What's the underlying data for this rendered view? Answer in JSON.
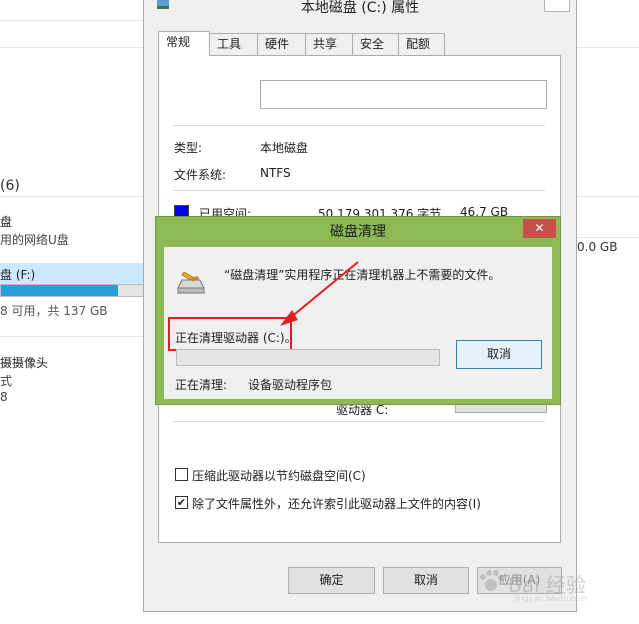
{
  "background_explorer": {
    "group_header": "(6)",
    "device_name_partial": "盘",
    "device_desc_partial": "用的网络U盘",
    "drive_label_partial": "盘 (F:)",
    "drive_free_partial": "8 可用，共 137 GB",
    "camera_name_partial": "摄摄像头",
    "camera_line2": "式",
    "camera_line3": "8",
    "right_size_partial": "0.0 GB",
    "drive_fill_percent": 81
  },
  "properties_dialog": {
    "title": "本地磁盘 (C:) 属性",
    "tabs": [
      "常规",
      "工具",
      "硬件",
      "共享",
      "安全",
      "配额"
    ],
    "active_tab": "常规",
    "name_value": "",
    "type_label": "类型:",
    "type_value": "本地磁盘",
    "fs_label": "文件系统:",
    "fs_value": "NTFS",
    "used_label": "已用空间:",
    "used_bytes": "50,179,301,376 字节",
    "used_gb": "46.7 GB",
    "drive_caption_partial": "驱动器 C:",
    "compress_label": "压缩此驱动器以节约磁盘空间(C)",
    "compress_checked": false,
    "index_label": "除了文件属性外，还允许索引此驱动器上文件的内容(I)",
    "index_checked": true,
    "ok_label": "确定",
    "cancel_label": "取消",
    "apply_partial": "应用(A)",
    "check_glyph": "✔"
  },
  "disk_cleanup_dialog": {
    "title": "磁盘清理",
    "close_glyph": "✕",
    "message": "“磁盘清理”实用程序正在清理机器上不需要的文件。",
    "status": "正在清理驱动器 (C:)。",
    "progress_percent": 0,
    "cancel_label": "取消",
    "current_label": "正在清理:",
    "current_value": "设备驱动程序包"
  },
  "annotation": {
    "box_color": "#e02020",
    "arrow_color": "#e02020"
  },
  "watermark": {
    "text": "Bai 经验",
    "sub": "jingyan.baidu.com"
  }
}
